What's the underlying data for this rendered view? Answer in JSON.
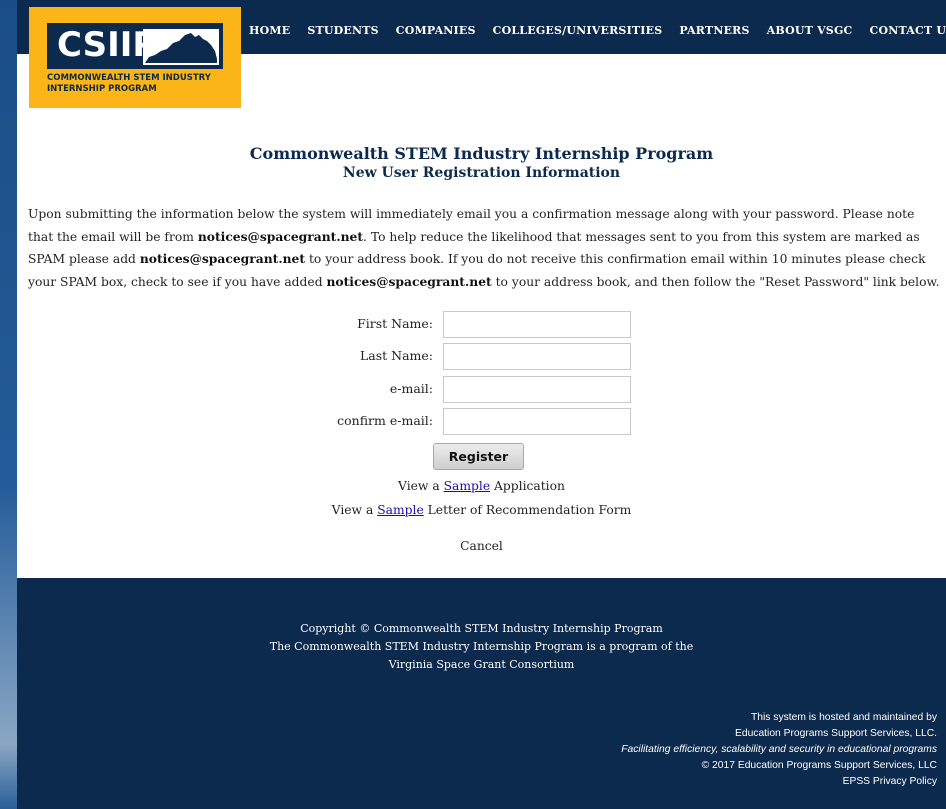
{
  "logo": {
    "text": "CSIIP",
    "caption_line1": "COMMONWEALTH STEM INDUSTRY",
    "caption_line2": "INTERNSHIP PROGRAM"
  },
  "nav": {
    "items": [
      "HOME",
      "STUDENTS",
      "COMPANIES",
      "COLLEGES/UNIVERSITIES",
      "PARTNERS",
      "ABOUT VSGC",
      "CONTACT US"
    ]
  },
  "main": {
    "title": "Commonwealth STEM Industry Internship Program",
    "subtitle": "New User Registration Information",
    "intro": {
      "p1": "Upon submitting the information below the system will immediately email you a confirmation message along with your password. Please note that the email will be from ",
      "email1": "notices@spacegrant.net",
      "p2": ". To help reduce the likelihood that messages sent to you from this system are marked as SPAM please add ",
      "email2": "notices@spacegrant.net",
      "p3": " to your address book. If you do not receive this confirmation email within 10 minutes please check your SPAM box, check to see if you have added ",
      "email3": "notices@spacegrant.net",
      "p4": " to your address book, and then follow the \"Reset Password\" link below."
    },
    "form": {
      "first_name_label": "First Name:",
      "first_name_value": "",
      "last_name_label": "Last Name:",
      "last_name_value": "",
      "email_label": "e-mail:",
      "email_value": "",
      "confirm_email_label": "confirm e-mail:",
      "confirm_email_value": "",
      "register_label": "Register"
    },
    "links": {
      "view_a_1": "View a ",
      "sample_1": "Sample",
      "application_suffix": " Application",
      "view_a_2": "View a ",
      "sample_2": "Sample",
      "letter_suffix": " Letter of Recommendation Form",
      "cancel": "Cancel"
    }
  },
  "footer": {
    "copyright": "Copyright © Commonwealth STEM Industry Internship Program",
    "program_line": "The Commonwealth STEM Industry Internship Program is a program of the",
    "consortium": "Virginia Space Grant Consortium",
    "hosted_line1": "This system is hosted and maintained by",
    "hosted_line2": "Education Programs Support Services, LLC.",
    "tagline": "Facilitating efficiency, scalability and security in educational programs",
    "copyright2": "© 2017 Education Programs Support Services, LLC",
    "privacy": "EPSS Privacy Policy"
  },
  "colors": {
    "navy": "#0b2a4d",
    "gold": "#fbb518",
    "link": "#1a0dab"
  }
}
